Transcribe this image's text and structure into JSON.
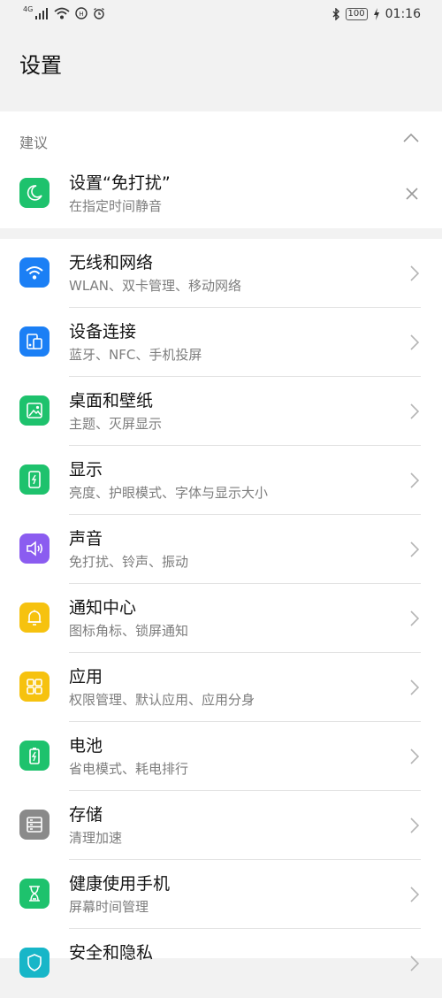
{
  "status_bar": {
    "network": "4G",
    "battery": "100",
    "time": "01:16"
  },
  "header": {
    "title": "设置"
  },
  "suggestion": {
    "section_label": "建议",
    "item": {
      "title": "设置“免打扰”",
      "subtitle": "在指定时间静音",
      "icon": "moon-icon",
      "color": "#1ec26d"
    }
  },
  "settings": {
    "items": [
      {
        "title": "无线和网络",
        "subtitle": "WLAN、双卡管理、移动网络",
        "icon": "wifi-icon",
        "color": "#1b7ff5"
      },
      {
        "title": "设备连接",
        "subtitle": "蓝牙、NFC、手机投屏",
        "icon": "device-connection-icon",
        "color": "#1b7ff5"
      },
      {
        "title": "桌面和壁纸",
        "subtitle": "主题、灭屏显示",
        "icon": "wallpaper-icon",
        "color": "#1ec26d"
      },
      {
        "title": "显示",
        "subtitle": "亮度、护眼模式、字体与显示大小",
        "icon": "display-icon",
        "color": "#1ec26d"
      },
      {
        "title": "声音",
        "subtitle": "免打扰、铃声、振动",
        "icon": "sound-icon",
        "color": "#8b5cf0"
      },
      {
        "title": "通知中心",
        "subtitle": "图标角标、锁屏通知",
        "icon": "bell-icon",
        "color": "#f6c20f"
      },
      {
        "title": "应用",
        "subtitle": "权限管理、默认应用、应用分身",
        "icon": "apps-icon",
        "color": "#f6c20f"
      },
      {
        "title": "电池",
        "subtitle": "省电模式、耗电排行",
        "icon": "battery-icon",
        "color": "#1ec26d"
      },
      {
        "title": "存储",
        "subtitle": "清理加速",
        "icon": "storage-icon",
        "color": "#8a8a8a"
      },
      {
        "title": "健康使用手机",
        "subtitle": "屏幕时间管理",
        "icon": "hourglass-icon",
        "color": "#1ec26d"
      },
      {
        "title": "安全和隐私",
        "subtitle": "",
        "icon": "shield-icon",
        "color": "#17b6c8"
      }
    ]
  }
}
